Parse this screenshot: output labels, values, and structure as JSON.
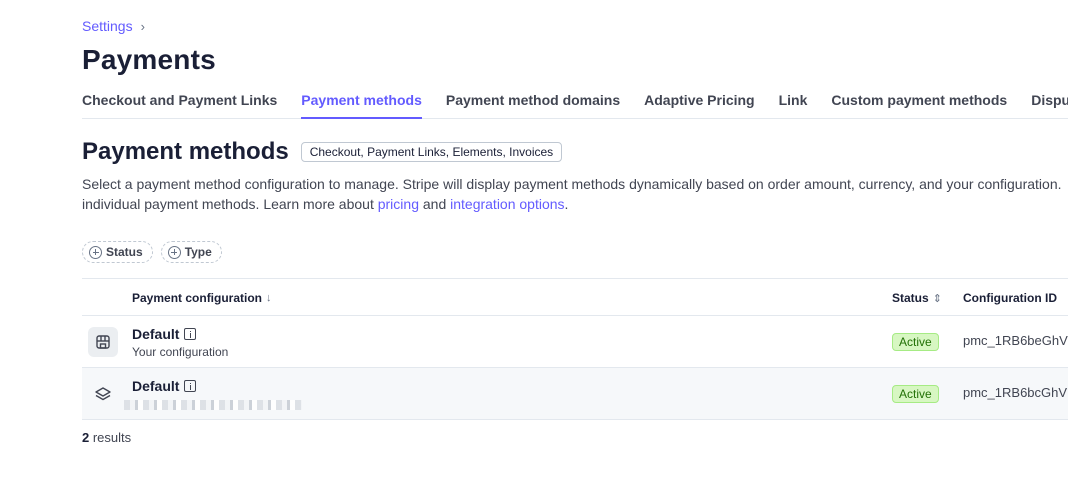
{
  "breadcrumb": {
    "parent": "Settings",
    "separator": "›"
  },
  "page": {
    "title": "Payments"
  },
  "tabs": [
    {
      "label": "Checkout and Payment Links",
      "active": false
    },
    {
      "label": "Payment methods",
      "active": true
    },
    {
      "label": "Payment method domains",
      "active": false
    },
    {
      "label": "Adaptive Pricing",
      "active": false
    },
    {
      "label": "Link",
      "active": false
    },
    {
      "label": "Custom payment methods",
      "active": false
    },
    {
      "label": "Disputes",
      "active": false
    }
  ],
  "section": {
    "title": "Payment methods",
    "products_badge": "Checkout, Payment Links, Elements, Invoices",
    "description_line1": "Select a payment method configuration to manage. Stripe will display payment methods dynamically based on order amount, currency, and your configuration.",
    "description_line2_prefix": "individual payment methods. Learn more about ",
    "pricing_link": "pricing",
    "and_text": " and ",
    "integration_link": "integration options",
    "period": "."
  },
  "filters": [
    {
      "label": "Status",
      "icon": "plus-circle-icon"
    },
    {
      "label": "Type",
      "icon": "plus-circle-icon"
    }
  ],
  "table": {
    "headers": {
      "config": "Payment configuration",
      "config_sort": "↓",
      "status": "Status",
      "status_sort": "⇕",
      "id": "Configuration ID"
    },
    "rows": [
      {
        "name": "Default",
        "subtitle": "Your configuration",
        "status": "Active",
        "config_id": "pmc_1RB6beGhV",
        "icon": "storefront-icon"
      },
      {
        "name": "Default",
        "subtitle": "",
        "status": "Active",
        "config_id": "pmc_1RB6bcGhV",
        "icon": "layers-icon"
      }
    ]
  },
  "results": {
    "count": "2",
    "label": " results"
  },
  "colors": {
    "accent": "#635bff",
    "active_badge_bg": "#d7f7c2",
    "active_badge_text": "#217005"
  }
}
